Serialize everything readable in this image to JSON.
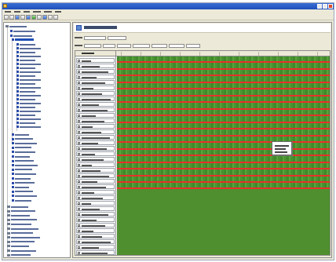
{
  "window": {
    "title": "",
    "menu_items": [
      "",
      "",
      "",
      "",
      "",
      ""
    ]
  },
  "colors": {
    "titlebar": "#1f4fb8",
    "band_green": "#4a9232",
    "band_red": "#e8302a",
    "selection": "#1f4fb8"
  },
  "icons": {
    "app": "app-icon",
    "minimize": "minimize-icon",
    "maximize": "maximize-icon",
    "close": "close-icon",
    "tree_node": "folder-icon",
    "drive": "drive-icon",
    "panel": "view-icon"
  },
  "panel": {
    "header_text": "",
    "grid_header_label": ""
  }
}
